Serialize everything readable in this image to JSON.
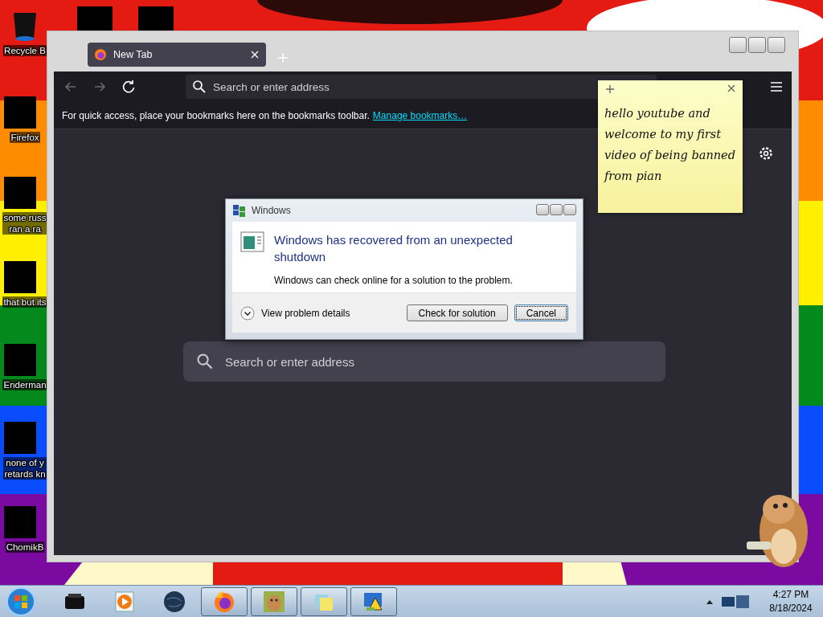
{
  "desktop": {
    "icons": [
      {
        "kind": "bin",
        "lines": [
          "Recycle B"
        ]
      },
      {
        "kind": "redacted",
        "lines": [
          "Firefox"
        ]
      },
      {
        "kind": "redacted",
        "lines": [
          "some russ",
          "ran a ra"
        ]
      },
      {
        "kind": "redacted",
        "lines": [
          "that but its"
        ]
      },
      {
        "kind": "redacted",
        "lines": [
          "Enderman"
        ]
      },
      {
        "kind": "redacted",
        "lines": [
          "none of y",
          "retards kn"
        ]
      },
      {
        "kind": "redacted",
        "lines": [
          "ChomikB"
        ]
      }
    ]
  },
  "browser": {
    "tab": {
      "title": "New Tab",
      "selected": true
    },
    "address_bar": {
      "placeholder": "Search or enter address"
    },
    "bookmarks_hint": "For quick access, place your bookmarks here on the bookmarks toolbar.",
    "bookmarks_link": "Manage bookmarks…",
    "page_search": {
      "placeholder": "Search or enter address"
    }
  },
  "dialog": {
    "title": "Windows",
    "heading": "Windows has recovered from an unexpected shutdown",
    "message": "Windows can check online for a solution to the problem.",
    "details": "View problem details",
    "buttons": [
      {
        "label": "Check for solution",
        "focused": false
      },
      {
        "label": "Cancel",
        "focused": true
      }
    ]
  },
  "sticky_note": {
    "text": "hello youtube and welcome to my first video of being banned from pian"
  },
  "taskbar": {
    "items": [
      {
        "kind": "printer",
        "running": false
      },
      {
        "kind": "media",
        "running": false
      },
      {
        "kind": "globe",
        "running": false
      },
      {
        "kind": "firefox",
        "running": true
      },
      {
        "kind": "hamster",
        "running": true
      },
      {
        "kind": "notes",
        "running": true
      },
      {
        "kind": "warning",
        "running": true
      }
    ],
    "time": "4:27 PM",
    "date": "8/18/2024"
  }
}
